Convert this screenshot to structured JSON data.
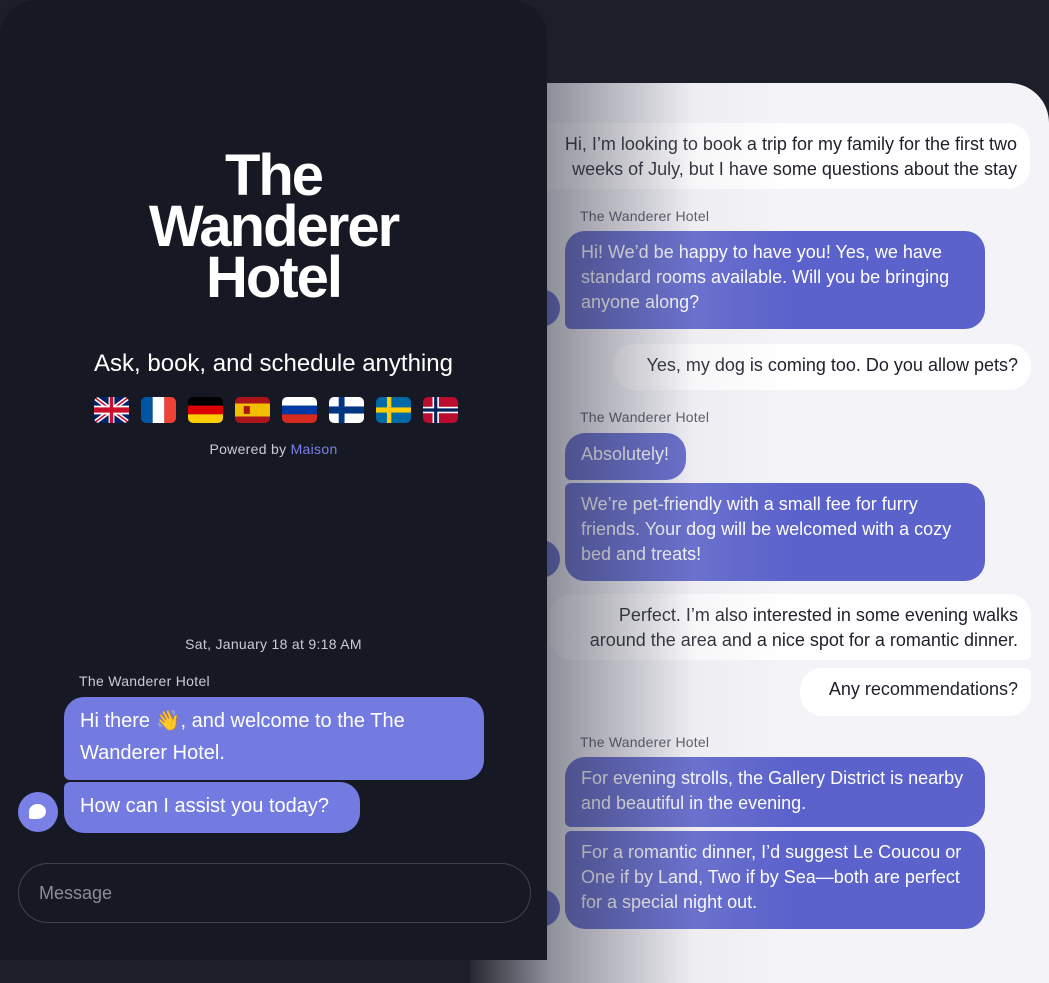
{
  "left": {
    "title_lines": [
      "The",
      "Wanderer",
      "Hotel"
    ],
    "tagline": "Ask, book, and schedule anything",
    "languages": [
      "English",
      "French",
      "German",
      "Spanish",
      "Russian",
      "Finnish",
      "Swedish",
      "Norwegian"
    ],
    "powered_prefix": "Powered by",
    "powered_link": "Maison",
    "timestamp": "Sat, January 18 at 9:18 AM",
    "sender": "The Wanderer Hotel",
    "messages": [
      "Hi there 👋, and welcome to the The Wanderer Hotel.",
      "How can I assist you today?"
    ],
    "input_placeholder": "Message"
  },
  "right": {
    "sender": "The Wanderer Hotel",
    "user_1": "Hi, I’m looking to book a trip for my family for the first two weeks of July, but I have some questions about the stay",
    "bot_1": "Hi! We’d be happy to have you! Yes, we have standard rooms available. Will you be bringing anyone along?",
    "user_2": "Yes, my dog is coming too. Do you allow pets?",
    "bot_2a": "Absolutely!",
    "bot_2b": "We’re pet-friendly with a small fee for furry friends. Your dog will be welcomed with a cozy bed and treats!",
    "user_3a": "Perfect. I’m also interested in some evening walks around the area and a nice spot for a romantic dinner.",
    "user_3b": "Any recommendations?",
    "bot_3a": "For evening strolls, the Gallery District is nearby and beautiful in the evening.",
    "bot_3b": "For a romantic dinner, I’d suggest Le Coucou or One if by Land, Two if by Sea—both are perfect for a special night out."
  },
  "colors": {
    "dark_bg": "#161923",
    "accent": "#737be0",
    "bot_bubble": "#5b62cc",
    "light_bg": "#f4f4f8"
  }
}
